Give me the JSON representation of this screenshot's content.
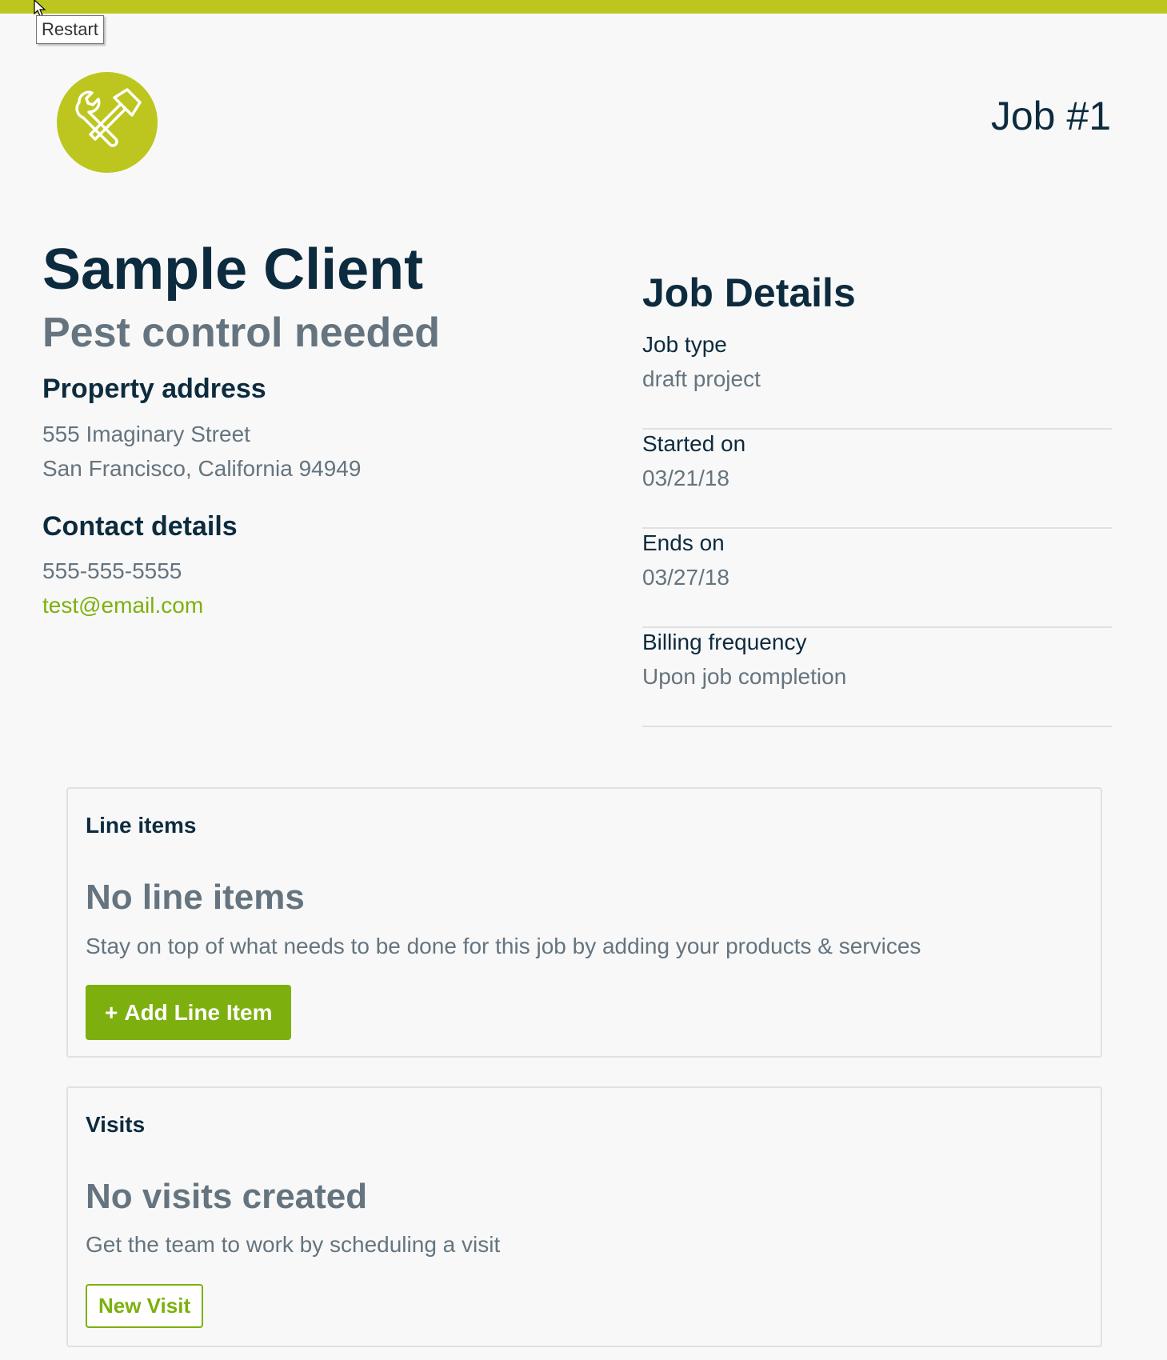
{
  "colors": {
    "brand": "#bcc61e",
    "accent_green": "#7db00e",
    "heading": "#0d2b3e",
    "muted": "#65747e",
    "divider": "#e1e1e1"
  },
  "tooltip": {
    "text": "Restart"
  },
  "header": {
    "logo_icon": "wrench-hammer-icon",
    "job_number": "Job #1"
  },
  "client": {
    "name": "Sample Client",
    "job_title": "Pest control needed",
    "property_heading": "Property address",
    "address_line1": "555 Imaginary Street",
    "address_line2": "San Francisco, California 94949",
    "contact_heading": "Contact details",
    "phone": "555-555-5555",
    "email": "test@email.com"
  },
  "job_details": {
    "title": "Job Details",
    "rows": [
      {
        "label": "Job type",
        "value": "draft project"
      },
      {
        "label": "Started on",
        "value": "03/21/18"
      },
      {
        "label": "Ends on",
        "value": "03/27/18"
      },
      {
        "label": "Billing frequency",
        "value": "Upon job completion"
      }
    ]
  },
  "line_items": {
    "title": "Line items",
    "empty_title": "No line items",
    "empty_text": "Stay on top of what needs to be done for this job by adding your products & services",
    "add_button": "Add Line Item",
    "add_button_icon": "+"
  },
  "visits": {
    "title": "Visits",
    "empty_title": "No visits created",
    "empty_text": "Get the team to work by scheduling a visit",
    "new_button": "New Visit"
  }
}
